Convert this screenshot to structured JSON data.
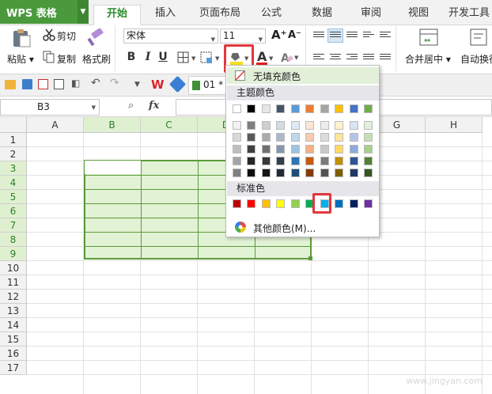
{
  "app": {
    "title": "WPS 表格"
  },
  "tabs": [
    {
      "label": "开始",
      "active": true
    },
    {
      "label": "插入"
    },
    {
      "label": "页面布局"
    },
    {
      "label": "公式"
    },
    {
      "label": "数据"
    },
    {
      "label": "审阅"
    },
    {
      "label": "视图"
    },
    {
      "label": "开发工具"
    }
  ],
  "ribbon": {
    "paste": "粘贴",
    "cut": "剪切",
    "copy": "复制",
    "format_painter": "格式刷",
    "font_name": "宋体",
    "font_size": "11",
    "bold": "B",
    "italic": "I",
    "underline": "U",
    "merge_center": "合并居中",
    "auto_wrap": "自动换行",
    "increase_font": "A⁺",
    "decrease_font": "A⁻",
    "font_color_letter": "A",
    "highlight_color": "#f5e01d",
    "font_color": "#e02020"
  },
  "qat": {
    "file_tab": "01 *"
  },
  "formula_bar": {
    "name_box": "B3",
    "fx": "fx",
    "value": ""
  },
  "grid": {
    "columns": [
      "A",
      "B",
      "C",
      "D",
      "E",
      "F",
      "G",
      "H"
    ],
    "rows": [
      "1",
      "2",
      "3",
      "4",
      "5",
      "6",
      "7",
      "8",
      "9",
      "10",
      "11",
      "12",
      "13",
      "14",
      "15",
      "16",
      "17"
    ],
    "selected_range": "B3:E9",
    "selected_fill": "#e2f2d5"
  },
  "color_menu": {
    "no_fill": "无填充颜色",
    "theme_colors_label": "主题颜色",
    "theme_top": [
      "#ffffff",
      "#000000",
      "#e7e6e6",
      "#44546a",
      "#5b9bd5",
      "#ed7d31",
      "#a5a5a5",
      "#ffc000",
      "#4472c4",
      "#70ad47"
    ],
    "theme_shades": [
      [
        "#f2f2f2",
        "#7f7f7f",
        "#d0cece",
        "#d6dce4",
        "#deebf6",
        "#fbe5d5",
        "#ededed",
        "#fff2cc",
        "#dae3f3",
        "#e2efd9"
      ],
      [
        "#d8d8d8",
        "#595959",
        "#aeabab",
        "#adb9ca",
        "#bdd7ee",
        "#f7cbac",
        "#dbdbdb",
        "#fee599",
        "#b4c6e7",
        "#c5e0b3"
      ],
      [
        "#bfbfbf",
        "#3f3f3f",
        "#757070",
        "#8496b0",
        "#9cc3e5",
        "#f4b183",
        "#c9c9c9",
        "#ffd965",
        "#8eaadb",
        "#a8d08d"
      ],
      [
        "#a5a5a5",
        "#262626",
        "#3a3838",
        "#323f4f",
        "#2e75b5",
        "#c55a11",
        "#7b7b7b",
        "#bf9000",
        "#2f5496",
        "#538135"
      ],
      [
        "#7f7f7f",
        "#0c0c0c",
        "#171616",
        "#222a35",
        "#1f4e79",
        "#833c0b",
        "#525252",
        "#7f6000",
        "#1f3864",
        "#375623"
      ]
    ],
    "standard_colors_label": "标准色",
    "standard": [
      "#c00000",
      "#ff0000",
      "#ffc000",
      "#ffff00",
      "#92d050",
      "#00b050",
      "#00b0f0",
      "#0070c0",
      "#002060",
      "#7030a0"
    ],
    "more_colors": "其他颜色(M)..."
  },
  "watermark": "www.jingyan.com"
}
